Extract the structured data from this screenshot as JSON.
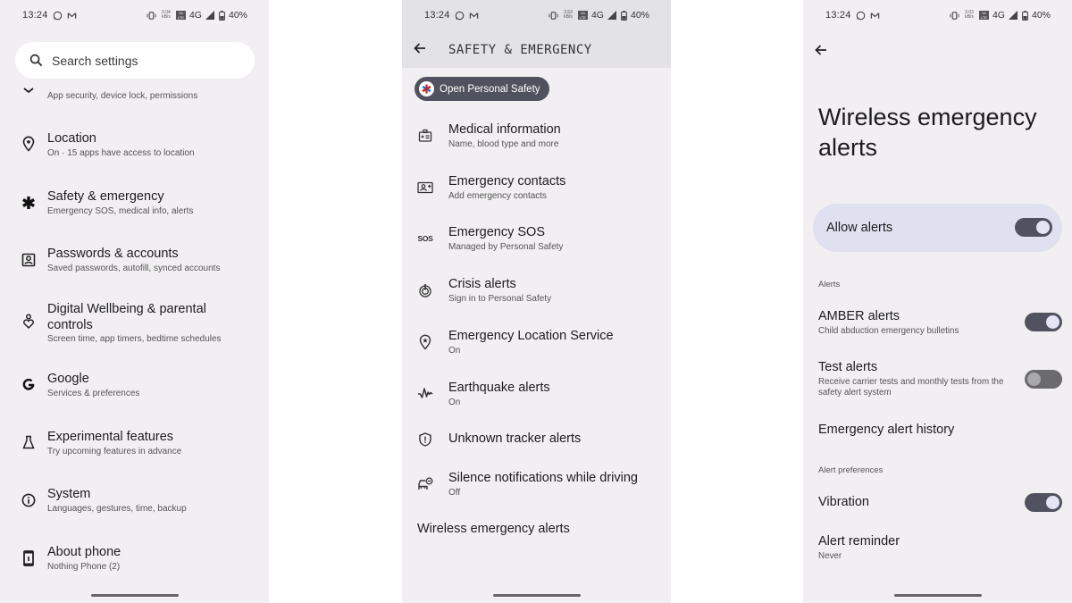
{
  "statusbar": [
    {
      "time": "13:24",
      "speed_top": "0.04",
      "speed_bottom": "kB/s",
      "network": "4G",
      "battery": "40%"
    },
    {
      "time": "13:24",
      "speed_top": "3.53",
      "speed_bottom": "kB/s",
      "network": "4G",
      "battery": "40%"
    },
    {
      "time": "13:24",
      "speed_top": "3.03",
      "speed_bottom": "kB/s",
      "network": "4G",
      "battery": "40%"
    }
  ],
  "settings": {
    "search_placeholder": "Search settings",
    "partial_item_sub": "App security, device lock, permissions",
    "items": [
      {
        "icon": "location-pin-icon",
        "title": "Location",
        "sub": "On · 15 apps have access to location"
      },
      {
        "icon": "asterisk-icon",
        "title": "Safety & emergency",
        "sub": "Emergency SOS, medical info, alerts"
      },
      {
        "icon": "account-box-icon",
        "title": "Passwords & accounts",
        "sub": "Saved passwords, autofill, synced accounts"
      },
      {
        "icon": "wellbeing-icon",
        "title": "Digital Wellbeing & parental controls",
        "title_line1": "Digital Wellbeing & parental",
        "title_line2": "controls",
        "sub": "Screen time, app timers, bedtime schedules"
      },
      {
        "icon": "google-icon",
        "title": "Google",
        "sub": "Services & preferences"
      },
      {
        "icon": "flask-icon",
        "title": "Experimental features",
        "sub": "Try upcoming features in advance"
      },
      {
        "icon": "info-icon",
        "title": "System",
        "sub": "Languages, gestures, time, backup"
      },
      {
        "icon": "phone-icon",
        "title": "About phone",
        "sub": "Nothing Phone (2)"
      }
    ]
  },
  "safety": {
    "header_title": "SAFETY & EMERGENCY",
    "chip_label": "Open Personal Safety",
    "items": [
      {
        "icon": "medical-id-icon",
        "title": "Medical information",
        "sub": "Name, blood type and more"
      },
      {
        "icon": "contact-add-icon",
        "title": "Emergency contacts",
        "sub": "Add emergency contacts"
      },
      {
        "icon": "sos-icon",
        "icon_text": "SOS",
        "title": "Emergency SOS",
        "sub": "Managed by Personal Safety"
      },
      {
        "icon": "crisis-alert-icon",
        "title": "Crisis alerts",
        "sub": "Sign in to Personal Safety"
      },
      {
        "icon": "location-star-icon",
        "title": "Emergency Location Service",
        "sub": "On"
      },
      {
        "icon": "earthquake-icon",
        "title": "Earthquake alerts",
        "sub": "On"
      },
      {
        "icon": "shield-alert-icon",
        "title": "Unknown tracker alerts",
        "sub": ""
      },
      {
        "icon": "car-silence-icon",
        "title": "Silence notifications while driving",
        "sub": "Off"
      }
    ],
    "plain_item": "Wireless emergency alerts"
  },
  "wea": {
    "title": "Wireless emergency alerts",
    "allow_label": "Allow alerts",
    "allow_on": true,
    "section_alerts": "Alerts",
    "amber_title": "AMBER alerts",
    "amber_sub": "Child abduction emergency bulletins",
    "amber_on": true,
    "test_title": "Test alerts",
    "test_sub": "Receive carrier tests and monthly tests from the safety alert system",
    "test_on": false,
    "history_title": "Emergency alert history",
    "section_prefs": "Alert preferences",
    "vibration_title": "Vibration",
    "vibration_on": true,
    "reminder_title": "Alert reminder",
    "reminder_sub": "Never"
  },
  "colors": {
    "panel_bg": "#f1eff1",
    "header_bg": "#e3e2e4",
    "accent_card": "#e0e1f0",
    "toggle_track_on": "#51525f",
    "chip_bg": "#51525f"
  }
}
